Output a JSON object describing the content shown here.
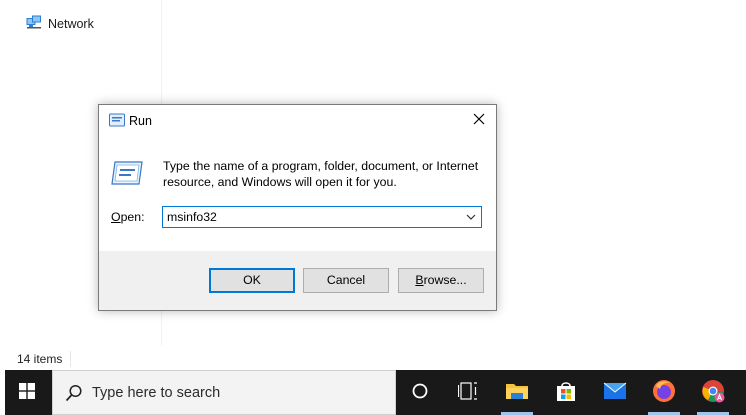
{
  "explorer": {
    "nav_network_label": "Network",
    "status_item_count": "14 items"
  },
  "run_dialog": {
    "title": "Run",
    "description": "Type the name of a program, folder, document, or Internet resource, and Windows will open it for you.",
    "open_label_prefix": "O",
    "open_label_rest": "pen:",
    "open_value": "msinfo32",
    "ok_label": "OK",
    "cancel_label": "Cancel",
    "browse_label_prefix": "B",
    "browse_label_rest": "rowse..."
  },
  "taskbar": {
    "search_placeholder": "Type here to search",
    "icons": [
      "windows-start-icon",
      "search-icon",
      "cortana-icon",
      "task-view-icon",
      "file-explorer-icon",
      "microsoft-store-icon",
      "mail-icon",
      "firefox-icon",
      "chrome-icon"
    ],
    "accent_color": "#0078d7"
  }
}
